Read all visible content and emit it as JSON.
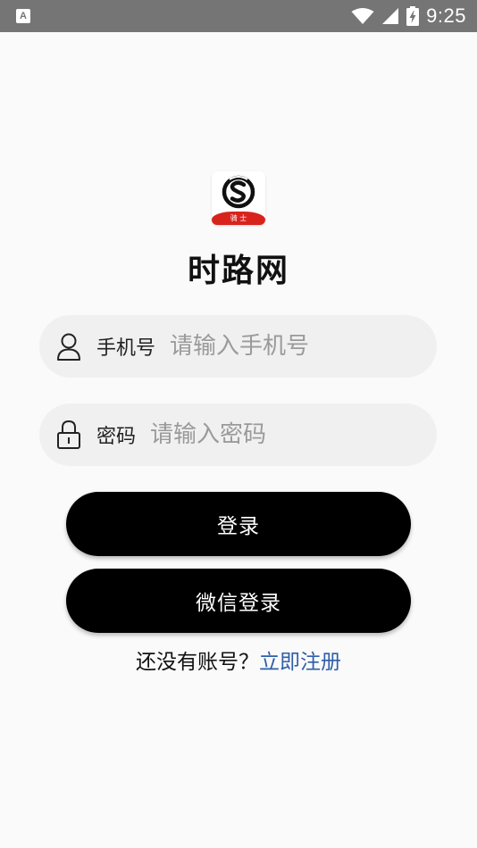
{
  "status_bar": {
    "notification_glyph": "A",
    "time": "9:25",
    "icons": [
      "wifi-icon",
      "cell-signal-icon",
      "battery-charging-icon"
    ]
  },
  "logo": {
    "ribbon_text": "骑 士",
    "colors": {
      "ring": "#111111",
      "ribbon": "#d8231d"
    }
  },
  "app_title": "时路网",
  "phone_field": {
    "label": "手机号",
    "value": "",
    "placeholder": "请输入手机号",
    "icon": "user-icon"
  },
  "password_field": {
    "label": "密码",
    "value": "",
    "placeholder": "请输入密码",
    "icon": "lock-icon"
  },
  "login_button": {
    "label": "登录"
  },
  "wechat_button": {
    "label": "微信登录"
  },
  "register": {
    "prompt": "还没有账号？",
    "link": "立即注册",
    "link_color": "#2f5fa8"
  }
}
